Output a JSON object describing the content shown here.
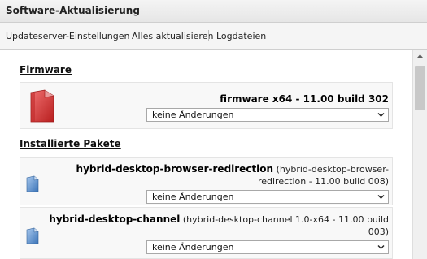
{
  "window": {
    "title": "Software-Aktualisierung"
  },
  "toolbar": {
    "update_server": "Updateserver-Einstellungen",
    "update_all": "Alles aktualisieren",
    "logfiles": "Logdateien"
  },
  "firmware": {
    "heading": "Firmware",
    "name": "firmware x64 - 11.00 build 302",
    "select_value": "keine Änderungen"
  },
  "installed": {
    "heading": "Installierte Pakete",
    "packages": [
      {
        "name": "hybrid-desktop-browser-redirection",
        "detail_1": "(hybrid-desktop-browser-",
        "detail_2": "redirection - 11.00 build 008)",
        "select_value": "keine Änderungen"
      },
      {
        "name": "hybrid-desktop-channel",
        "detail_1": "(hybrid-desktop-channel 1.0-x64 - 11.00 build",
        "detail_2": "003)",
        "select_value": "keine Änderungen"
      }
    ]
  },
  "colors": {
    "icon_red": "#d23a3a",
    "icon_blue": "#4a86c8"
  }
}
